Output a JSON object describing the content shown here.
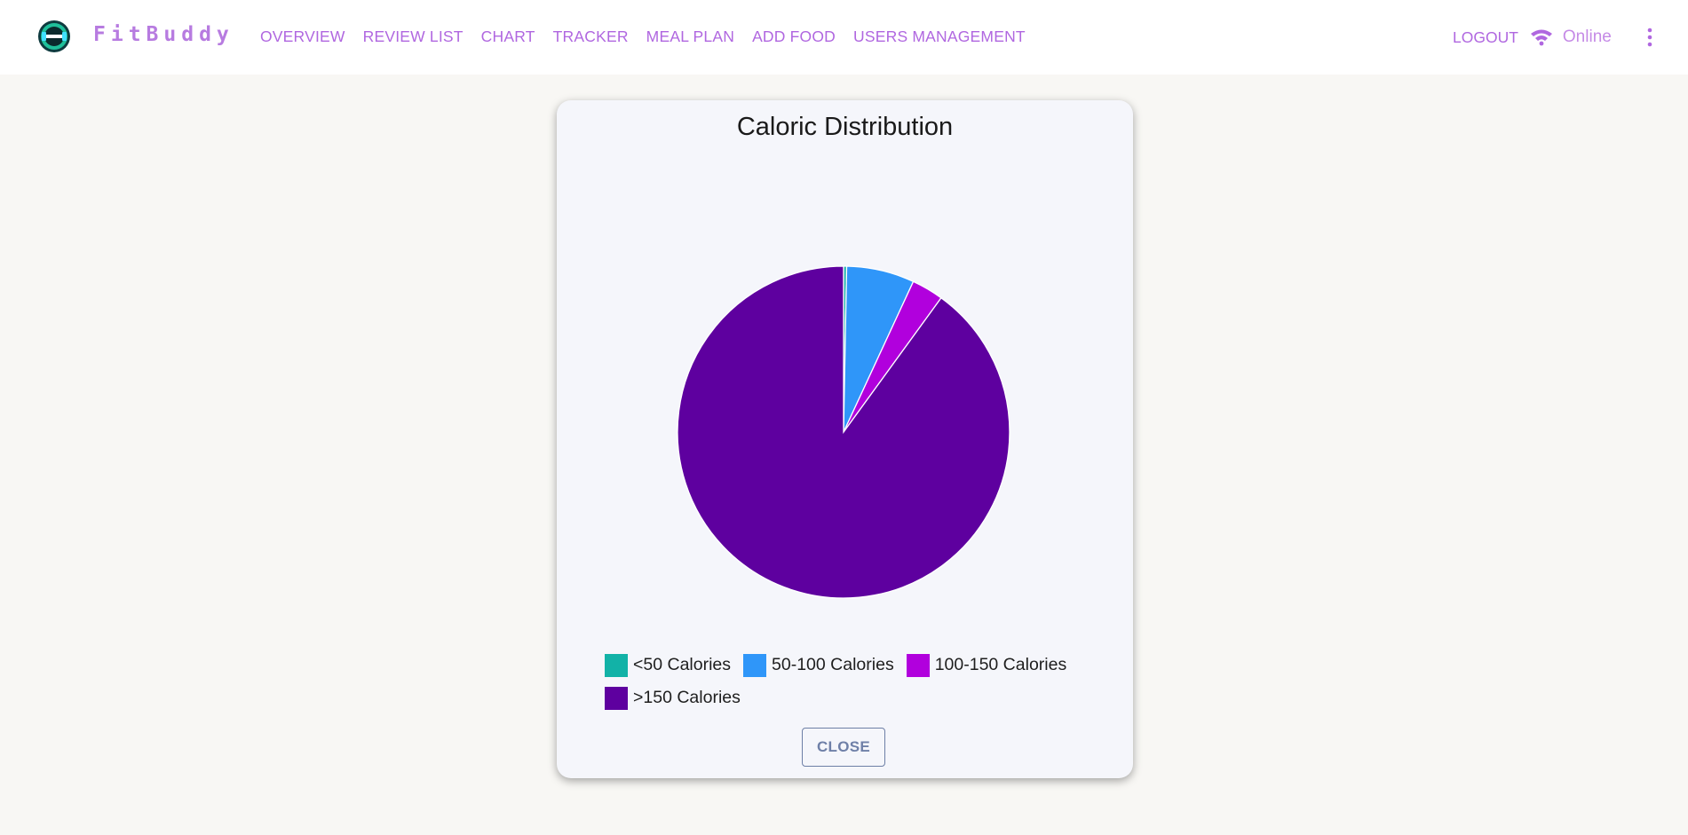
{
  "app": {
    "brand": "FitBuddy"
  },
  "nav": {
    "items": [
      {
        "label": "OVERVIEW"
      },
      {
        "label": "REVIEW LIST"
      },
      {
        "label": "CHART"
      },
      {
        "label": "TRACKER"
      },
      {
        "label": "MEAL PLAN"
      },
      {
        "label": "ADD FOOD"
      },
      {
        "label": "USERS MANAGEMENT"
      }
    ],
    "logout_label": "LOGOUT",
    "status_label": "Online"
  },
  "colors": {
    "nav_text": "#b067e0",
    "brand": "#b77be0",
    "accent_outline": "#6f80a8"
  },
  "dialog": {
    "close_label": "CLOSE"
  },
  "chart_data": {
    "type": "pie",
    "title": "Caloric Distribution",
    "categories": [
      "<50 Calories",
      "50-100 Calories",
      "100-150 Calories",
      ">150 Calories"
    ],
    "values": [
      0.3,
      6.6,
      3.1,
      90.0
    ],
    "colors": [
      "#12b2a7",
      "#2f96f9",
      "#b100dd",
      "#5e009f"
    ],
    "legend_position": "bottom"
  }
}
